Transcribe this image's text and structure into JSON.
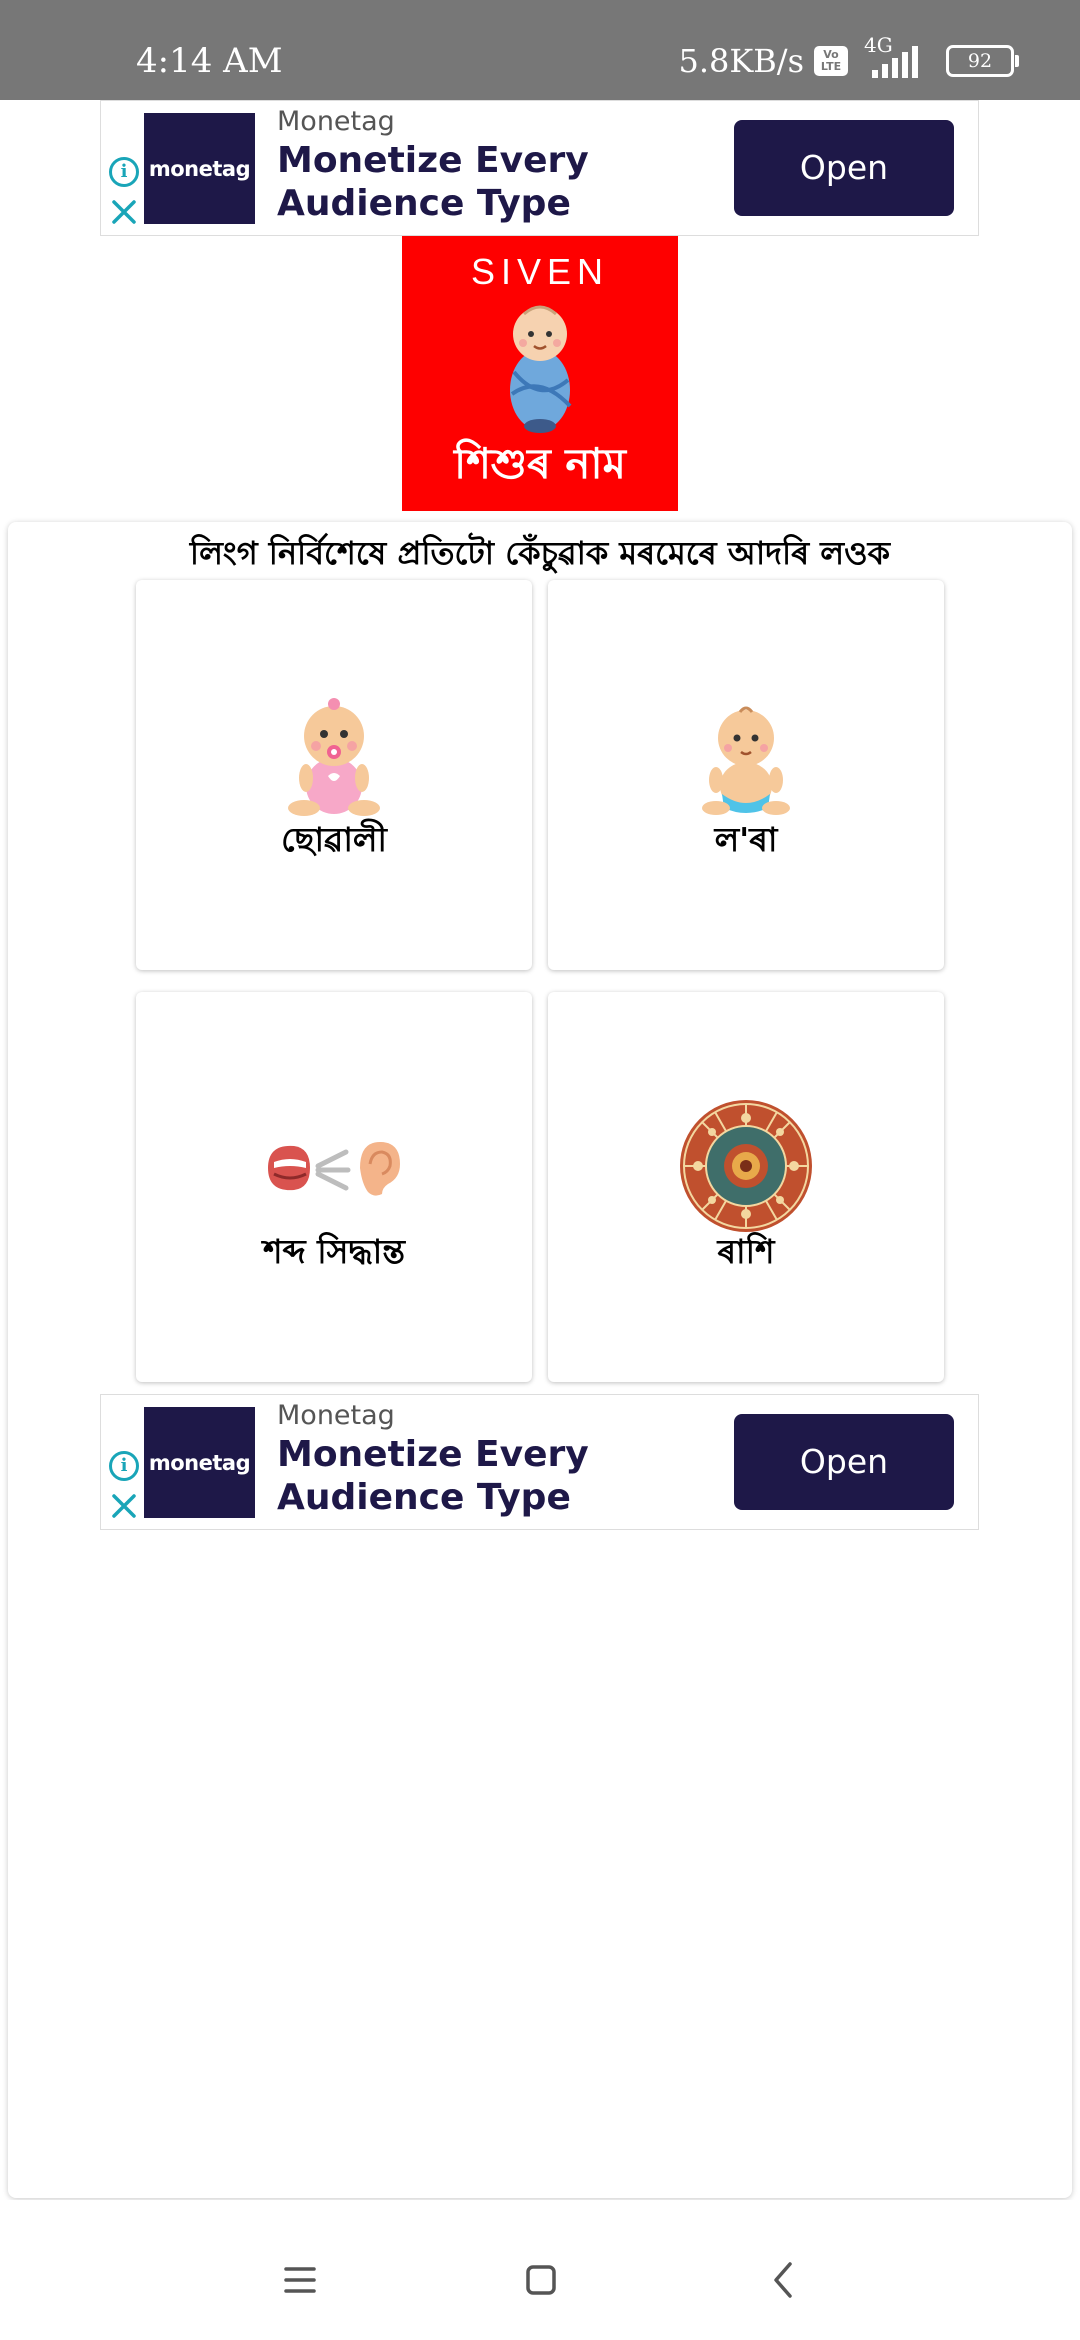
{
  "status_bar": {
    "time": "4:14 AM",
    "net_speed": "5.8KB/s",
    "volte_top": "Vo",
    "volte_bottom": "LTE",
    "network_type": "4G",
    "battery": "92"
  },
  "ads": [
    {
      "brand": "Monetag",
      "logo_text": "monetag",
      "headline": "Monetize Every Audience Type",
      "button_label": "Open"
    },
    {
      "brand": "Monetag",
      "logo_text": "monetag",
      "headline": "Monetize Every Audience Type",
      "button_label": "Open"
    }
  ],
  "app_logo": {
    "brand": "SIVEN",
    "title": "শিশুৰ নাম"
  },
  "main": {
    "heading": "লিংগ নিৰ্বিশেষে প্ৰতিটো কেঁচুৱাক মৰমেৰে আদৰি লওক",
    "tiles": [
      {
        "label": "ছোৱালী",
        "icon": "baby-girl-icon"
      },
      {
        "label": "ল'ৰা",
        "icon": "baby-boy-icon"
      },
      {
        "label": "শব্দ সিদ্ধান্ত",
        "icon": "mouth-ear-sound-icon"
      },
      {
        "label": "ৰাশি",
        "icon": "zodiac-wheel-icon"
      }
    ]
  },
  "nav": {
    "icons": [
      "menu-icon",
      "home-icon",
      "back-icon"
    ]
  },
  "colors": {
    "status_bar": "#777777",
    "ad_dark": "#1e1848",
    "ad_info": "#19a5b8",
    "logo_red": "#fe0000"
  }
}
